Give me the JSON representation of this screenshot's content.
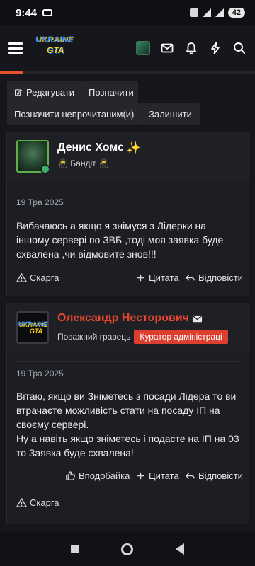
{
  "status_bar": {
    "time": "9:44",
    "battery": "42"
  },
  "header": {
    "logo_top": "UKRAINE",
    "logo_bottom": "GTA"
  },
  "thread_actions": {
    "edit": "Редагувати",
    "mark": "Позначити",
    "mark_unread": "Позначити непрочитаним(и)",
    "leave": "Залишити"
  },
  "posts": [
    {
      "author": "Денис Хомс",
      "author_emoji": "✨",
      "user_title": "🥷 Бандіт 🥷",
      "date": "19 Тра 2025",
      "body": "Вибачаюсь а якщо я знімуся з Лідерки на іншому сервері по ЗВБ ,тоді моя заявка буде схвалена ,чи відмовите знов!!!",
      "actions": {
        "report": "Скарга",
        "quote": "Цитата",
        "reply": "Відповісти"
      }
    },
    {
      "author": "Олександр Несторович",
      "user_title": "Поважний гравець",
      "badge": "Куратор адміністраці",
      "avatar_top": "UKRAINE",
      "avatar_bottom": "GTA",
      "date": "19 Тра 2025",
      "body_line1": "Вітаю, якщо ви Зніметесь з посади Лідера то ви втрачаєте можливість стати на посаду ІП на своєму сервері.",
      "body_line2": "Ну а навіть якщо зніметесь і подасте на ІП на 03 то Заявка буде схвалена!",
      "actions": {
        "like": "Вподобайка",
        "quote": "Цитата",
        "reply": "Відповісти",
        "report": "Скарга"
      }
    }
  ],
  "colors": {
    "accent": "#e8502e",
    "staff_badge": "#dc3e2f",
    "background": "#16171c"
  },
  "page_progress": 0.09
}
